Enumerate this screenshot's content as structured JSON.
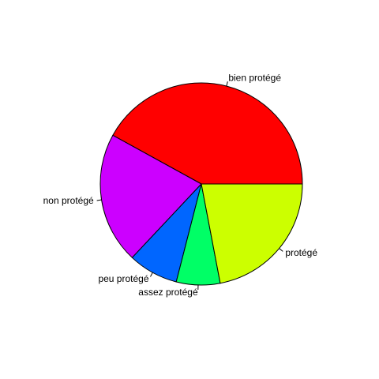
{
  "chart_data": {
    "type": "pie",
    "categories": [
      "bien protégé",
      "non protégé",
      "peu protégé",
      "assez protégé",
      "protégé"
    ],
    "values": [
      42,
      21,
      8,
      7,
      22
    ],
    "colors": [
      "#FF0000",
      "#CC00FF",
      "#0066FF",
      "#00FF66",
      "#CCFF00"
    ],
    "start_angle_deg": 0,
    "direction": "counterclockwise",
    "title": "",
    "legend": "none"
  }
}
